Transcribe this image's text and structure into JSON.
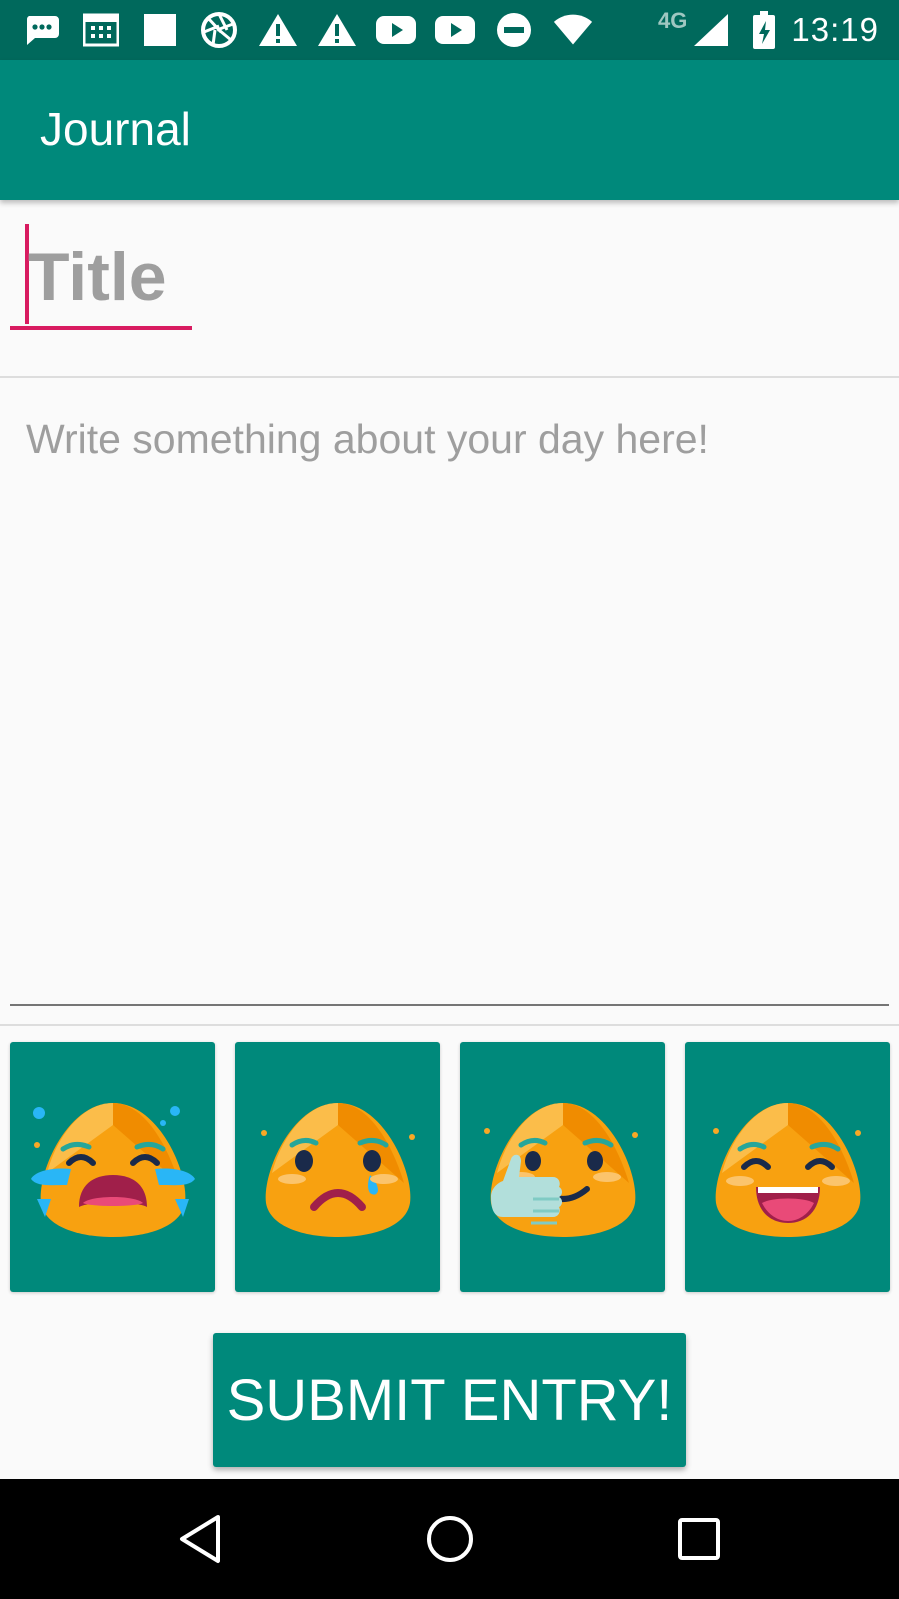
{
  "status_bar": {
    "icons": [
      "chat-bubble-icon",
      "calendar-icon",
      "square-icon",
      "aperture-icon",
      "warning-icon",
      "warning-icon",
      "youtube-icon",
      "youtube-icon",
      "do-not-disturb-icon",
      "wifi-icon",
      "signal-icon",
      "battery-charging-icon"
    ],
    "network": "4G",
    "time": "13:19"
  },
  "app_bar": {
    "title": "Journal"
  },
  "title_field": {
    "placeholder": "Title",
    "value": ""
  },
  "body_field": {
    "placeholder": "Write something about your day here!",
    "value": ""
  },
  "moods": [
    {
      "id": "crying",
      "icon": "crying-face-icon"
    },
    {
      "id": "sad",
      "icon": "sad-face-icon"
    },
    {
      "id": "okay",
      "icon": "thumbs-up-face-icon"
    },
    {
      "id": "happy",
      "icon": "laughing-face-icon"
    }
  ],
  "submit_button": {
    "label": "SUBMIT ENTRY!"
  },
  "nav_bar": {
    "back": "back-icon",
    "home": "home-icon",
    "recents": "recents-icon"
  },
  "colors": {
    "status_bar": "#00695c",
    "primary": "#00897b",
    "accent": "#d81b60",
    "background": "#fafafa",
    "hint_text": "#9e9e9e",
    "emoji_face": "#f8a110"
  }
}
